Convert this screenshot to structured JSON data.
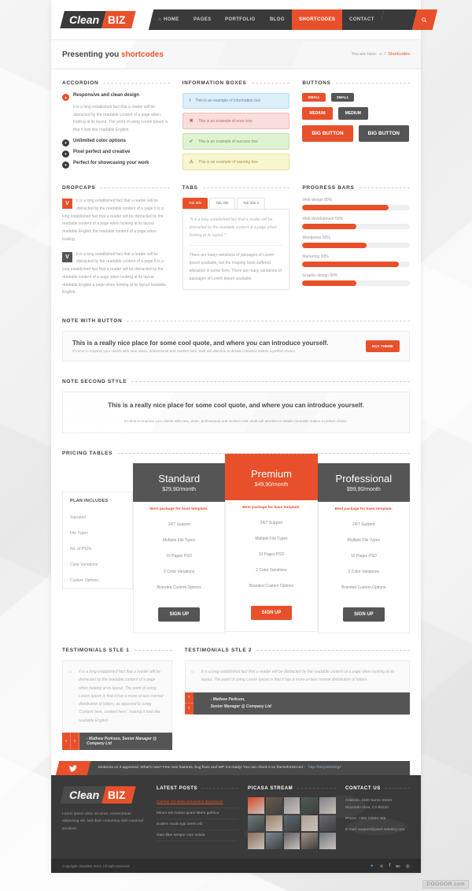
{
  "header": {
    "logo": {
      "part1": "Clean",
      "part2": "BIZ"
    },
    "nav": [
      {
        "label": "HOME",
        "icon": "home-icon",
        "active": false
      },
      {
        "label": "PAGES",
        "active": false
      },
      {
        "label": "PORTFOLIO",
        "active": false
      },
      {
        "label": "BLOG",
        "active": false
      },
      {
        "label": "SHORTCODES",
        "active": true
      },
      {
        "label": "CONTACT",
        "active": false
      }
    ],
    "search_icon": "search-icon"
  },
  "breadcrumb": {
    "title_prefix": "Presenting you ",
    "title_highlight": "shortcodes",
    "you_are_here": "You are here:",
    "home_icon": "home-icon",
    "separator": "/",
    "current": "Shortcodes"
  },
  "accordion": {
    "heading": "ACCORDION",
    "items": [
      {
        "title": "Responsive and clean design",
        "open": true,
        "body": "It is a long established fact that a reader will be distracted by the readable content of a page when looking at its layout. The point of using Lorem Ipsum is that it look like readable English."
      },
      {
        "title": "Unlimited color options",
        "open": false
      },
      {
        "title": "Pixel perfect and creative",
        "open": false
      },
      {
        "title": "Perfect for showcasing your work",
        "open": false
      }
    ]
  },
  "information_boxes": {
    "heading": "INFORMATION BOXES",
    "boxes": [
      {
        "type": "info",
        "glyph": "i",
        "text": "This is an example of information box"
      },
      {
        "type": "error",
        "glyph": "✖",
        "text": "This is an example of error box"
      },
      {
        "type": "success",
        "glyph": "✔",
        "text": "This is an example of success box"
      },
      {
        "type": "warning",
        "glyph": "⚠",
        "text": "This is an example of warning box"
      }
    ]
  },
  "buttons": {
    "heading": "BUTTONS",
    "rows": [
      {
        "size": "sm",
        "items": [
          {
            "label": "SMALL",
            "color": "orange"
          },
          {
            "label": "SMALL",
            "color": "dark"
          }
        ]
      },
      {
        "size": "md",
        "items": [
          {
            "label": "MEDIUM",
            "color": "orange"
          },
          {
            "label": "MEDIUM",
            "color": "dark"
          }
        ]
      },
      {
        "size": "lg",
        "items": [
          {
            "label": "BIG BUTTON",
            "color": "orange"
          },
          {
            "label": "BIG BUTTON",
            "color": "dark"
          }
        ]
      }
    ]
  },
  "dropcaps": {
    "heading": "DROPCAPS",
    "blocks": [
      {
        "letter": "V",
        "style": "o",
        "text": "It is a long established fact that a reader will be distracted by the readable content of a page It is a long established fact that a reader will be distracted by the readable content of a page when looking at its layout readable English the readable content of a page when looking."
      },
      {
        "letter": "V",
        "style": "d",
        "text": "It is a long established fact that a reader will be distracted by the readable content of a page It is a long established fact that a reader will be distracted by the readable content of a page when looking at its layout readable English a page when looking at its layout readable English."
      }
    ]
  },
  "tabs": {
    "heading": "TABS",
    "items": [
      {
        "label": "Tab title",
        "active": true
      },
      {
        "label": "Tab title",
        "active": false
      },
      {
        "label": "Tab title 3",
        "active": false
      }
    ],
    "quote": "\"It is a long established fact that a reader will be distracted by the readable content of a page when looking at its layout.\"",
    "paragraph": "There are many variations of passages of Lorem Ipsum available, but the majority have suffered alteration in some form. There are many variations of passages of Lorem Ipsum available."
  },
  "progress_bars": {
    "heading": "PROGRESS BARS",
    "bars": [
      {
        "label": "Web design 80%",
        "value": 80
      },
      {
        "label": "Web development 50%",
        "value": 50
      },
      {
        "label": "Wordpress 60%",
        "value": 60
      },
      {
        "label": "Marketing 90%",
        "value": 90
      },
      {
        "label": "Graphic design 50%",
        "value": 50
      }
    ]
  },
  "note_with_button": {
    "heading": "NOTE WITH BUTTON",
    "title": "This is a really nice place for some cool quote, and where you can introduce yourself.",
    "subtitle": "It's time to impress your clients with new, clean, professional and modern look. Built wih atention to details CleanBiz makes a perfect choice.",
    "button": "BUY THEME"
  },
  "note_second_style": {
    "heading": "NOTE SECOND STYLE",
    "title": "This is a really nice place for some cool quote, and where you can introduce yourself.",
    "subtitle": "It's time to impress your clients with new, clean, professional and modern look. Built wih atention to details CleanBiz makes a perfect choice."
  },
  "pricing": {
    "heading": "PRICING TABLES",
    "plan_includes_label": "PLAN INCLUDES",
    "feature_labels": [
      "Supoport",
      "File Types",
      "No. of PSDs",
      "Color Variations",
      "Custom Options"
    ],
    "plans": [
      {
        "name": "Standard",
        "price": "$29,90/month",
        "featured": false,
        "tagline": "Best package for base template.",
        "features": [
          "24/7 Support",
          "Multiple File Types",
          "10 Pages PSD",
          "2 Color Variations",
          "Branded Custom Options"
        ],
        "cta": "SIGN UP"
      },
      {
        "name": "Premium",
        "price": "$49,90/month",
        "featured": true,
        "tagline": "Best package for base template.",
        "features": [
          "24/7 Support",
          "Multiple File Types",
          "10 Pages PSD",
          "2 Color Variations",
          "Branded Custom Options"
        ],
        "cta": "SIGN UP"
      },
      {
        "name": "Professional",
        "price": "$99,90/month",
        "featured": false,
        "tagline": "Best package for base template.",
        "features": [
          "24/7 Support",
          "Multiple File Types",
          "10 Pages PSD",
          "2 Color Variations",
          "Branded Custom Options"
        ],
        "cta": "SIGN UP"
      }
    ]
  },
  "testimonials1": {
    "heading": "TESTIMONIALS STLE 1",
    "quote": "It is a long established fact that a reader will be distracted by the readable content of a page when looking at its layout. The point of using Lorem Ipsum is that it has a more-or-less normal distribution of letters, as opposed to using 'Content here, content here', making it look like readable English.",
    "author": "- Mathew Perkson, Senior Manager @ Company Ltd",
    "prev_icon": "chevron-left-icon",
    "next_icon": "chevron-right-icon"
  },
  "testimonials2": {
    "heading": "TESTIMONIALS STLE 2",
    "quote": "It is a long established fact that a reader will be distracted by the readable content of a page when looking at its layout. The point of using Lorem Ipsum is that it has a more-or-less normal distribution of letters.",
    "author_line1": "- Mathew Perkson,",
    "author_line2": "Senior Manager @ Company Ltd",
    "next_icon": "chevron-right-icon",
    "prev_icon": "chevron-left-icon"
  },
  "twitter_bar": {
    "icon": "twitter-icon",
    "text": "Moderna v1.3 approved. What's new? Few new features, bug fixes and WP 3.5 ready! You can check it on themeforest.net -",
    "link": "http://bit.ly/ZDODgT"
  },
  "footer": {
    "logo": {
      "part1": "Clean",
      "part2": "BIZ"
    },
    "about": "Lorem ipsum dolor sit amet, consectetuer adipiscing elit, sed diam nonummy nibh euismod tincidunt.",
    "latest_posts": {
      "title": "LATEST POSTS",
      "items": [
        "Claritas est etiam processus dynamicus",
        "Mirum est notare quam littera gothica",
        "Eodem modo typi lorem elit",
        "Nam liber tempor cum soluta"
      ]
    },
    "picasa": {
      "title": "PICASA STREAM",
      "count": 15
    },
    "contact": {
      "title": "CONTACT US",
      "address_line1": "Address: 1600 Some Street",
      "address_line2": "Mountain View, CA 90210",
      "phone": "Phone: +381 22828 465",
      "email": "E-mail:  support@pixel-industry.com"
    }
  },
  "copyright": {
    "text": "Copyright cleanBIZ 2013. All right reserved",
    "socials": [
      "twitter-icon",
      "dribbble-icon",
      "facebook-icon",
      "behance-icon",
      "skype-icon"
    ]
  },
  "watermark": "DOOOOR.com"
}
